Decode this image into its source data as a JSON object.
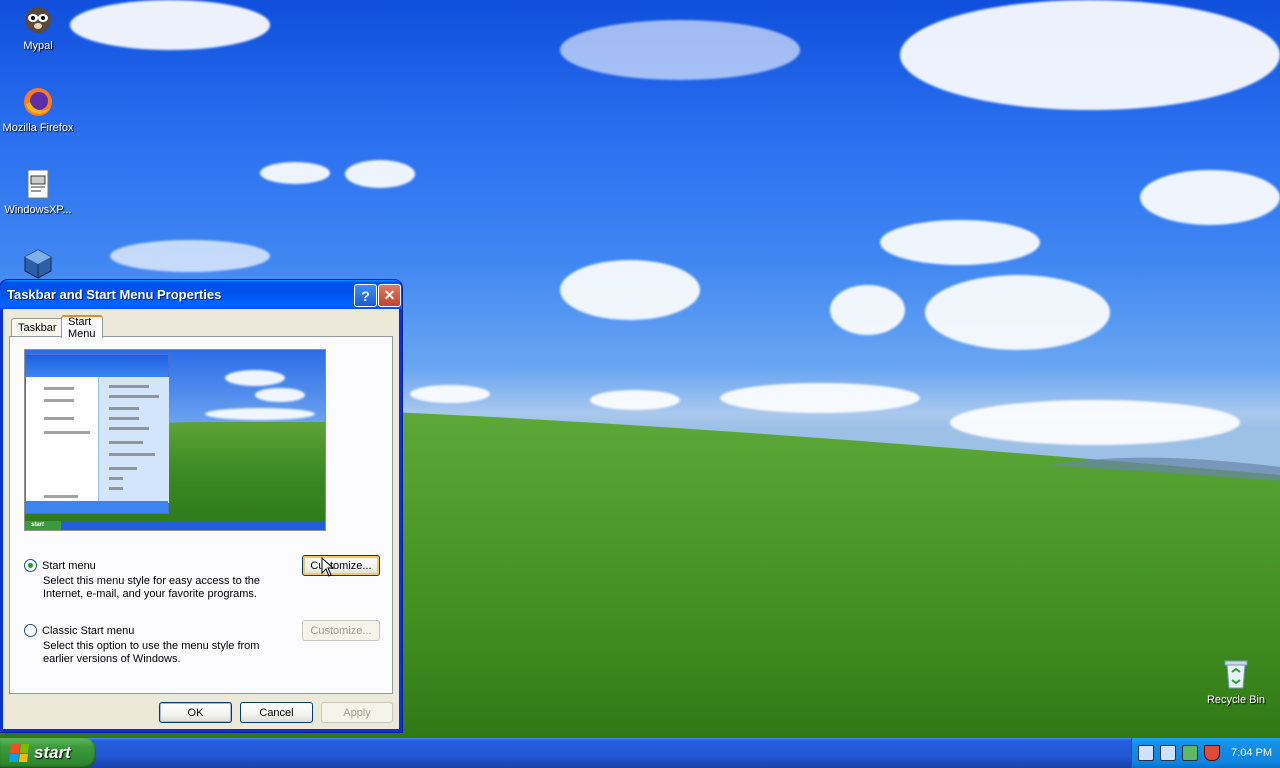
{
  "desktop": {
    "icons": [
      {
        "label": "Mypal",
        "icon": "mypal-raccoon-icon"
      },
      {
        "label": "Mozilla Firefox",
        "icon": "firefox-icon"
      },
      {
        "label": "WindowsXP...",
        "icon": "document-file-icon"
      },
      {
        "label": "",
        "icon": "virtualbox-cube-icon"
      },
      {
        "label": "Recycle Bin",
        "icon": "recycle-bin-icon"
      }
    ]
  },
  "dialog": {
    "title": "Taskbar and Start Menu Properties",
    "help_glyph": "?",
    "close_glyph": "✕",
    "tabs": [
      {
        "label": "Taskbar",
        "active": false
      },
      {
        "label": "Start Menu",
        "active": true
      }
    ],
    "options": {
      "start_menu": {
        "label": "Start menu",
        "selected": true,
        "description": "Select this menu style for easy access to the Internet, e-mail, and your favorite programs.",
        "customize_label": "Customize...",
        "customize_enabled": true
      },
      "classic": {
        "label": "Classic Start menu",
        "selected": false,
        "description": "Select this option to use the menu style from earlier versions of Windows.",
        "customize_label": "Customize...",
        "customize_enabled": false
      }
    },
    "buttons": {
      "ok": "OK",
      "cancel": "Cancel",
      "apply": "Apply"
    },
    "preview": {
      "start_label": "start"
    }
  },
  "taskbar": {
    "start_label": "start",
    "clock": "7:04 PM",
    "tray_icons": [
      "network-icon",
      "network-icon",
      "safely-remove-icon",
      "security-shield-icon"
    ]
  },
  "colors": {
    "title_bar": "#0058ee",
    "taskbar": "#245edb",
    "start_button": "#3c9a3c",
    "dialog_face": "#ece9d8"
  }
}
